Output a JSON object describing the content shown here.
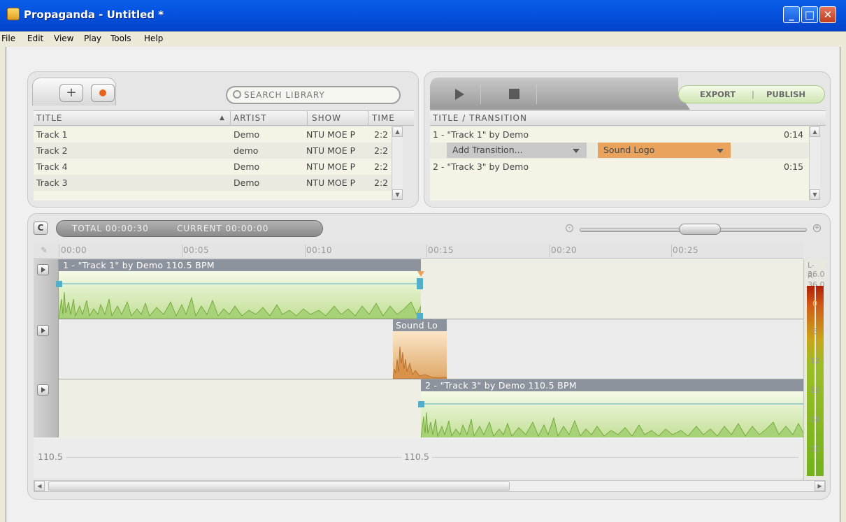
{
  "window": {
    "title": "Propaganda - Untitled *"
  },
  "menu": [
    "File",
    "Edit",
    "View",
    "Play",
    "Tools",
    "Help"
  ],
  "library": {
    "search_placeholder": "SEARCH LIBRARY",
    "columns": [
      "TITLE",
      "ARTIST",
      "SHOW",
      "TIME"
    ],
    "rows": [
      {
        "title": "Track 1",
        "artist": "Demo",
        "show": "NTU MOE P",
        "time": "2:2"
      },
      {
        "title": "Track 2",
        "artist": "demo",
        "show": "NTU MOE P",
        "time": "2:2"
      },
      {
        "title": "Track 4",
        "artist": "Demo",
        "show": "NTU MOE P",
        "time": "2:2"
      },
      {
        "title": "Track 3",
        "artist": "Demo",
        "show": "NTU MOE P",
        "time": "2:2"
      }
    ]
  },
  "playlist": {
    "export_label": "EXPORT",
    "publish_label": "PUBLISH",
    "column": "TITLE / TRANSITION",
    "items": [
      {
        "label": "1 - \"Track 1\" by Demo",
        "time": "0:14"
      },
      {
        "label": "2 - \"Track 3\" by Demo",
        "time": "0:15"
      }
    ],
    "transition_select": "Add Transition...",
    "soundlogo_select": "Sound Logo"
  },
  "timeline": {
    "total": "TOTAL 00:00:30",
    "current": "CURRENT 00:00:00",
    "ruler": [
      "00:00",
      "00:05",
      "00:10",
      "00:15",
      "00:20",
      "00:25"
    ],
    "clips": [
      "1 - \"Track 1\" by Demo 110.5 BPM",
      "Sound Lo",
      "2 - \"Track 3\" by Demo 110.5 BPM"
    ],
    "bpm_markers": [
      "110.5",
      "110.5"
    ],
    "meter": {
      "left": "L-36.0",
      "right": "R-36.0",
      "scale": [
        "0",
        "6",
        "12",
        "18",
        "24",
        "30"
      ]
    }
  },
  "colors": {
    "accent_orange": "#e9a35c",
    "clip_green": "#a8d277",
    "titlebar_blue": "#0553e0"
  }
}
